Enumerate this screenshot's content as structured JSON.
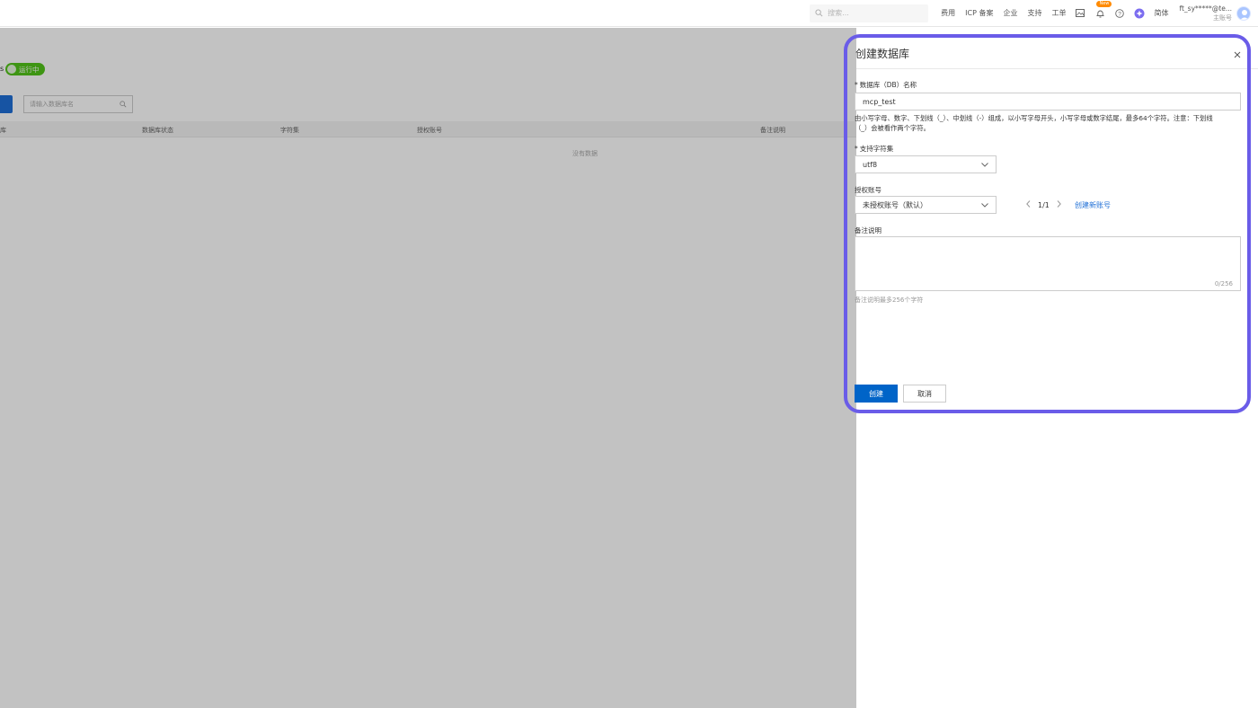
{
  "topbar": {
    "search_placeholder": "搜索...",
    "nav": [
      "费用",
      "ICP 备案",
      "企业",
      "支持",
      "工单"
    ],
    "new_badge": "New",
    "lang": "简体",
    "user_name": "ft_sy*****@te...",
    "user_role": "主账号"
  },
  "background": {
    "status_prefix": "s",
    "status_label": "运行中",
    "search_placeholder": "请输入数据库名",
    "columns": [
      "库",
      "数据库状态",
      "字符集",
      "授权账号",
      "备注说明"
    ],
    "empty_text": "没有数据"
  },
  "drawer": {
    "title": "创建数据库",
    "db_name": {
      "required_mark": "*",
      "label": "数据库（DB）名称",
      "value": "mcp_test",
      "hint_line1": "由小写字母、数字、下划线（_）、中划线（-）组成，以小写字母开头，小写字母或数字结尾，最多64个字符。注意：下划线",
      "hint_line2": "（_）会被看作两个字符。"
    },
    "charset": {
      "required_mark": "*",
      "label": "支持字符集",
      "value": "utf8"
    },
    "account": {
      "label": "授权账号",
      "value": "未授权账号（默认）",
      "pager": "1/1",
      "create_link": "创建新账号"
    },
    "remark": {
      "label": "备注说明",
      "counter": "0/256",
      "hint": "备注说明最多256个字符"
    },
    "buttons": {
      "create": "创建",
      "cancel": "取消"
    }
  },
  "colors": {
    "highlight": "#6a5ce8",
    "primary": "#0064c8",
    "link": "#1f6fd6",
    "status_green": "#52c41a"
  }
}
